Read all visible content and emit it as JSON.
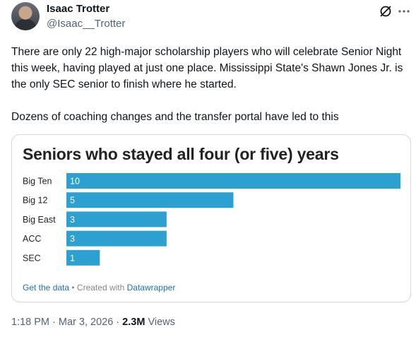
{
  "author": {
    "name": "Isaac Trotter",
    "handle": "@Isaac__Trotter"
  },
  "tweet": {
    "text": "There are only 22 high-major scholarship players who will celebrate Senior Night this week, having played at just one place. Mississippi State's Shawn Jones Jr. is the only SEC senior to finish where he started.\n\nDozens of coaching changes and the transfer portal have led to this"
  },
  "chart_data": {
    "type": "bar",
    "orientation": "horizontal",
    "title": "Seniors who stayed all four (or five) years",
    "categories": [
      "Big Ten",
      "Big 12",
      "Big East",
      "ACC",
      "SEC"
    ],
    "values": [
      10,
      5,
      3,
      3,
      1
    ],
    "xlim": [
      0,
      10
    ],
    "bar_color": "#2ca0d0",
    "grid": false
  },
  "card_footer": {
    "link": "Get the data",
    "separator": " • ",
    "created": "Created with ",
    "tool": "Datawrapper"
  },
  "meta": {
    "time": "1:18 PM",
    "dot1": " · ",
    "date": "Mar 3, 2026",
    "dot2": " · ",
    "views_count": "2.3M",
    "views_label": " Views"
  },
  "icons": [
    "grok-icon",
    "more-icon"
  ]
}
